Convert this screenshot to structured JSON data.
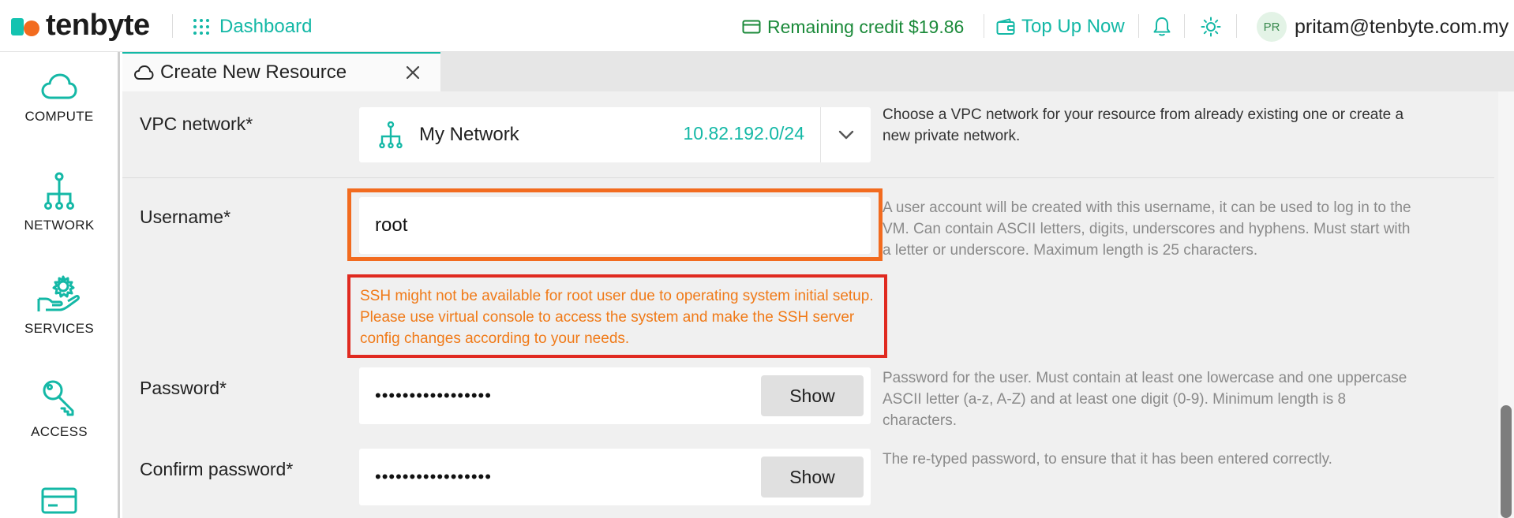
{
  "header": {
    "brand": "tenbyte",
    "dashboard_label": "Dashboard",
    "credit_label": "Remaining credit $19.86",
    "topup_label": "Top Up Now",
    "avatar_initials": "PR",
    "user_email": "pritam@tenbyte.com.my",
    "icons": [
      "grid-icon",
      "wallet-card-icon",
      "wallet-icon",
      "bell-icon",
      "sun-icon"
    ]
  },
  "sidebar": {
    "items": [
      {
        "label": "COMPUTE",
        "icon": "cloud-icon"
      },
      {
        "label": "NETWORK",
        "icon": "network-icon"
      },
      {
        "label": "SERVICES",
        "icon": "services-icon"
      },
      {
        "label": "ACCESS",
        "icon": "key-icon"
      },
      {
        "label": "",
        "icon": "billing-card-icon"
      }
    ]
  },
  "tab": {
    "title": "Create New Resource",
    "icon": "cloud-icon"
  },
  "form": {
    "vpc": {
      "label": "VPC network*",
      "name": "My Network",
      "cidr": "10.82.192.0/24",
      "help": "Choose a VPC network for your resource from already existing one or create a new private network."
    },
    "username": {
      "label": "Username*",
      "value": "root",
      "help": "A user account will be created with this username, it can be used to log in to the VM. Can contain ASCII letters, digits, underscores and hyphens. Must start with a letter or underscore. Maximum length is 25 characters.",
      "warning": "SSH might not be available for root user due to operating system initial setup. Please use virtual console to access the system and make the SSH server config changes according to your needs."
    },
    "password": {
      "label": "Password*",
      "value": "•••••••••••••••••",
      "show_label": "Show",
      "help": "Password for the user. Must contain at least one lowercase and one uppercase ASCII letter (a-z, A-Z) and at least one digit (0-9). Minimum length is 8 characters."
    },
    "confirm_password": {
      "label": "Confirm password*",
      "value": "•••••••••••••••••",
      "show_label": "Show",
      "help": "The re-typed password, to ensure that it has been entered correctly."
    }
  },
  "colors": {
    "accent": "#14b8a6",
    "brand_orange": "#f26b1f",
    "credit_green": "#1b8a3a",
    "warning_text": "#f07a18",
    "warning_border": "#e02a20"
  }
}
